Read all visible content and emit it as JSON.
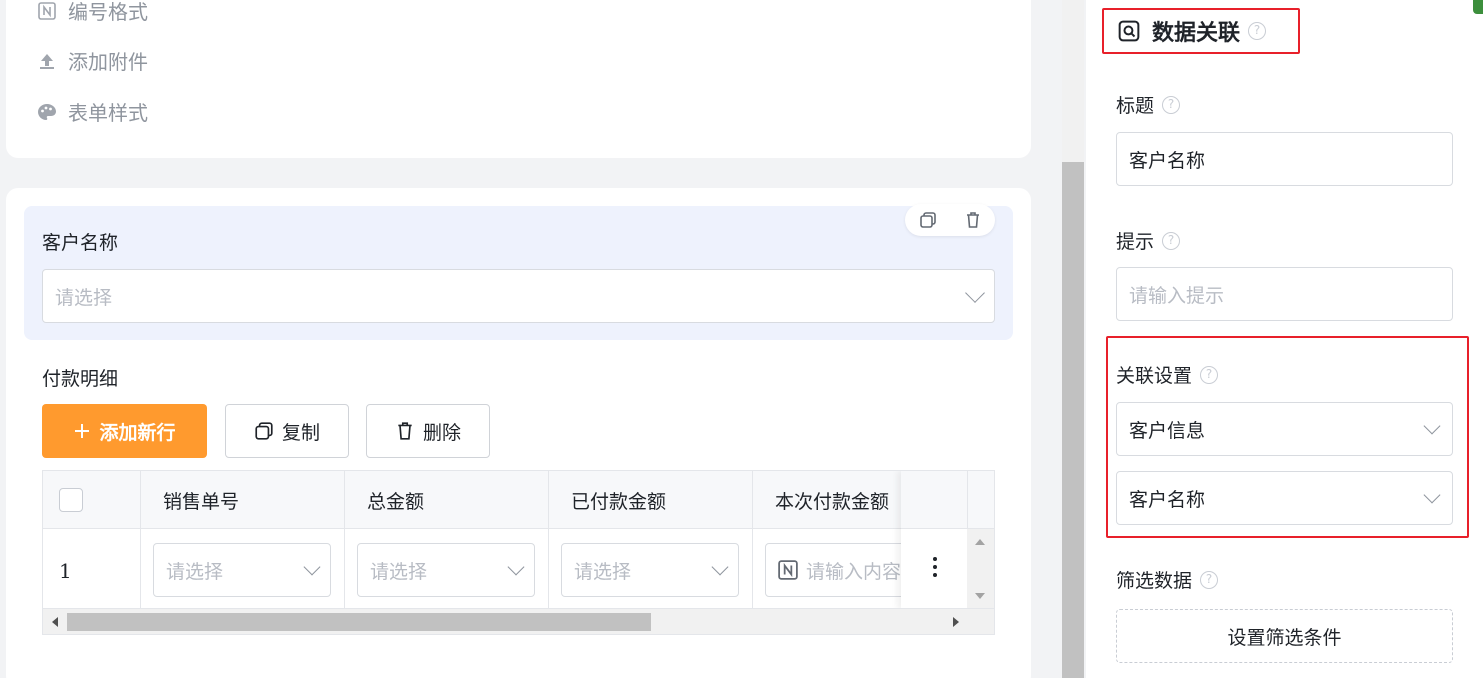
{
  "left_menu": {
    "items": [
      {
        "label": "编号格式",
        "icon": "number-format-icon"
      },
      {
        "label": "添加附件",
        "icon": "upload-icon"
      },
      {
        "label": "表单样式",
        "icon": "palette-icon"
      }
    ]
  },
  "field": {
    "label": "客户名称",
    "placeholder": "请选择"
  },
  "detail": {
    "title": "付款明细",
    "add_label": "添加新行",
    "copy_label": "复制",
    "delete_label": "删除"
  },
  "table": {
    "columns": [
      "销售单号",
      "总金额",
      "已付款金额",
      "本次付款金额"
    ],
    "row_number": "1",
    "cell_placeholders": [
      "请选择",
      "请选择",
      "请选择",
      "请输入内容"
    ]
  },
  "panel": {
    "title": "数据关联",
    "title_label": "标题",
    "title_value": "客户名称",
    "hint_label": "提示",
    "hint_placeholder": "请输入提示",
    "link_label": "关联设置",
    "link_source": "客户信息",
    "link_field": "客户名称",
    "filter_label": "筛选数据",
    "filter_button": "设置筛选条件",
    "help_glyph": "?"
  },
  "colors": {
    "accent": "#ff9a2e",
    "highlight_border": "#e8202a",
    "field_bg": "#eef2fd"
  }
}
